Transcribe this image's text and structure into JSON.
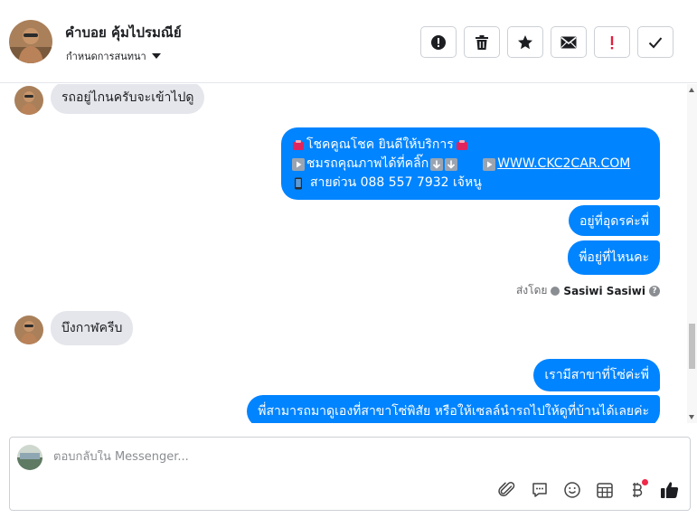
{
  "header": {
    "contact_name": "คำบอย คุ้มไปรมณีย์",
    "conversation_menu_label": "กำหนดการสนทนา"
  },
  "actions": [
    {
      "name": "report-button",
      "icon": "alert-circle-icon"
    },
    {
      "name": "delete-button",
      "icon": "trash-icon"
    },
    {
      "name": "star-button",
      "icon": "star-icon"
    },
    {
      "name": "mark-unread-button",
      "icon": "envelope-icon"
    },
    {
      "name": "follow-up-button",
      "icon": "exclamation-icon"
    },
    {
      "name": "done-button",
      "icon": "check-icon"
    }
  ],
  "messages": {
    "m1": "รถอยู่ไกนครับจะเข้าไปดู",
    "promo_line1": "โชคคูณโชค ยินดีให้บริการ",
    "promo_line2a": "ชมรถคุณภาพได้ที่คลิ๊ก",
    "promo_link": "WWW.CKC2CAR.COM",
    "promo_line3": "สายด่วน 088 557 7932 เจ้หนู",
    "m3": "อยู่ที่อุดรค่ะพี่",
    "m4": "พี่อยู่ที่ไหนคะ",
    "sent_by_label": "ส่งโดย",
    "sent_by_name": "Sasiwi Sasiwi",
    "m5": "บึงกาฬครีบ",
    "m6": "เรามีสาขาที่โซ่ค่ะพี่",
    "m7": "พี่สามารถมาดูเองที่สาขาโซ่พิสัย หรือให้เซลล์นำรถไปให้ดูที่บ้านได้เลยค่ะ"
  },
  "composer": {
    "placeholder": "ตอบกลับใน Messenger..."
  },
  "colors": {
    "accent": "#0084ff",
    "incoming_bubble": "#e4e6eb",
    "notification_dot": "#f02849"
  }
}
